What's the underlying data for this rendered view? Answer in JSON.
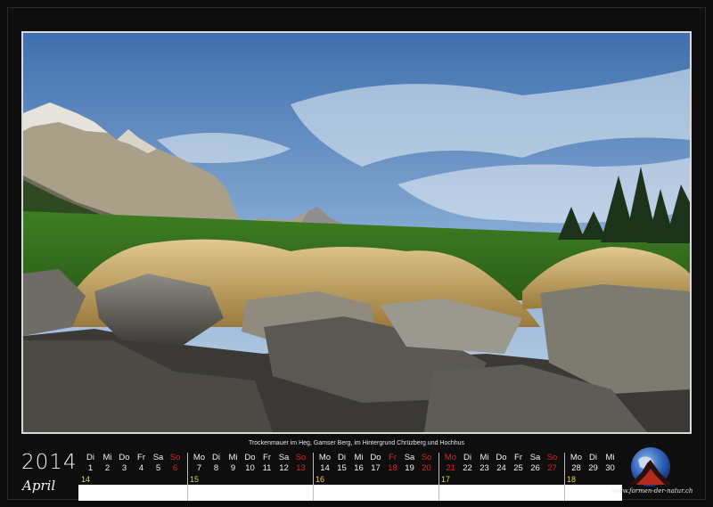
{
  "photo": {
    "caption": "Trockenmauer im Heg, Gamser Berg, im Hintergrund Chrüzberg und Hochhus"
  },
  "calendar": {
    "year": "2014",
    "month": "April",
    "weeks": [
      {
        "number": "14",
        "days": [
          {
            "dn": "Di",
            "dd": "1",
            "red": false
          },
          {
            "dn": "Mi",
            "dd": "2",
            "red": false
          },
          {
            "dn": "Do",
            "dd": "3",
            "red": false
          },
          {
            "dn": "Fr",
            "dd": "4",
            "red": false
          },
          {
            "dn": "Sa",
            "dd": "5",
            "red": false
          },
          {
            "dn": "So",
            "dd": "6",
            "red": true
          }
        ]
      },
      {
        "number": "15",
        "days": [
          {
            "dn": "Mo",
            "dd": "7",
            "red": false
          },
          {
            "dn": "Di",
            "dd": "8",
            "red": false
          },
          {
            "dn": "Mi",
            "dd": "9",
            "red": false
          },
          {
            "dn": "Do",
            "dd": "10",
            "red": false
          },
          {
            "dn": "Fr",
            "dd": "11",
            "red": false
          },
          {
            "dn": "Sa",
            "dd": "12",
            "red": false
          },
          {
            "dn": "So",
            "dd": "13",
            "red": true
          }
        ]
      },
      {
        "number": "16",
        "days": [
          {
            "dn": "Mo",
            "dd": "14",
            "red": false
          },
          {
            "dn": "Di",
            "dd": "15",
            "red": false
          },
          {
            "dn": "Mi",
            "dd": "16",
            "red": false
          },
          {
            "dn": "Do",
            "dd": "17",
            "red": false
          },
          {
            "dn": "Fr",
            "dd": "18",
            "red": true
          },
          {
            "dn": "Sa",
            "dd": "19",
            "red": false
          },
          {
            "dn": "So",
            "dd": "20",
            "red": true
          }
        ]
      },
      {
        "number": "17",
        "days": [
          {
            "dn": "Mo",
            "dd": "21",
            "red": true
          },
          {
            "dn": "Di",
            "dd": "22",
            "red": false
          },
          {
            "dn": "Mi",
            "dd": "23",
            "red": false
          },
          {
            "dn": "Do",
            "dd": "24",
            "red": false
          },
          {
            "dn": "Fr",
            "dd": "25",
            "red": false
          },
          {
            "dn": "Sa",
            "dd": "26",
            "red": false
          },
          {
            "dn": "So",
            "dd": "27",
            "red": true
          }
        ]
      },
      {
        "number": "18",
        "days": [
          {
            "dn": "Mo",
            "dd": "28",
            "red": false
          },
          {
            "dn": "Di",
            "dd": "29",
            "red": false
          },
          {
            "dn": "Mi",
            "dd": "30",
            "red": false
          }
        ]
      }
    ]
  },
  "logo": {
    "icon": "globe-with-mountain-icon",
    "text": "www.formen-der-natur.ch"
  },
  "colors": {
    "holiday_red": "#e0231b",
    "week_number_yellow": "#e8d44a",
    "background": "#0b0b0b"
  }
}
